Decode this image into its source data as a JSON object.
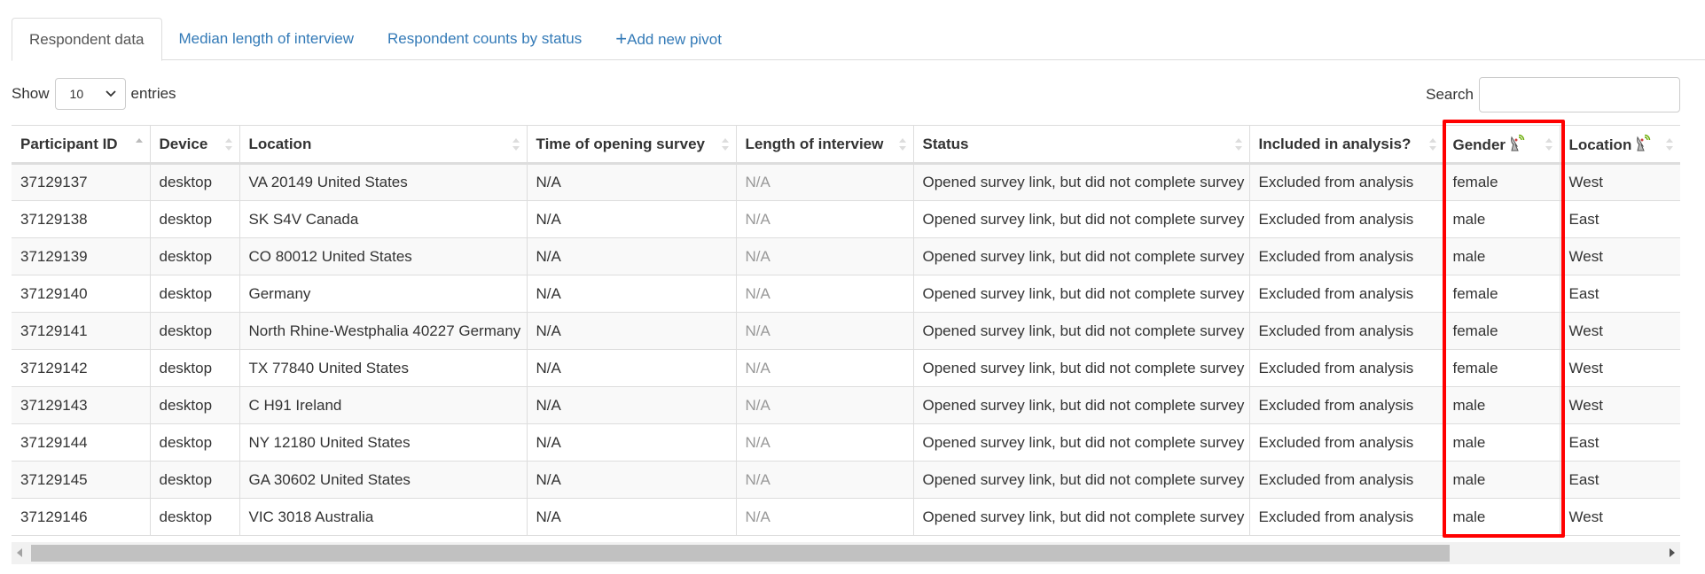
{
  "tabs": [
    {
      "label": "Respondent data",
      "active": true
    },
    {
      "label": "Median length of interview"
    },
    {
      "label": "Respondent counts by status"
    },
    {
      "label": "Add new pivot",
      "icon": "plus-icon"
    }
  ],
  "length": {
    "show": "Show",
    "value": "10",
    "entries": "entries"
  },
  "search": {
    "label": "Search",
    "value": ""
  },
  "columns": [
    "Participant ID",
    "Device",
    "Location",
    "Time of opening survey",
    "Length of interview",
    "Status",
    "Included in analysis?",
    "Gender",
    "Location"
  ],
  "rows": [
    [
      "37129137",
      "desktop",
      "VA 20149 United States",
      "N/A",
      "N/A",
      "Opened survey link, but did not complete survey",
      "Excluded from analysis",
      "female",
      "West"
    ],
    [
      "37129138",
      "desktop",
      "SK S4V Canada",
      "N/A",
      "N/A",
      "Opened survey link, but did not complete survey",
      "Excluded from analysis",
      "male",
      "East"
    ],
    [
      "37129139",
      "desktop",
      "CO 80012 United States",
      "N/A",
      "N/A",
      "Opened survey link, but did not complete survey",
      "Excluded from analysis",
      "male",
      "West"
    ],
    [
      "37129140",
      "desktop",
      "Germany",
      "N/A",
      "N/A",
      "Opened survey link, but did not complete survey",
      "Excluded from analysis",
      "female",
      "East"
    ],
    [
      "37129141",
      "desktop",
      "North Rhine-Westphalia 40227 Germany",
      "N/A",
      "N/A",
      "Opened survey link, but did not complete survey",
      "Excluded from analysis",
      "female",
      "West"
    ],
    [
      "37129142",
      "desktop",
      "TX 77840 United States",
      "N/A",
      "N/A",
      "Opened survey link, but did not complete survey",
      "Excluded from analysis",
      "female",
      "West"
    ],
    [
      "37129143",
      "desktop",
      "C H91 Ireland",
      "N/A",
      "N/A",
      "Opened survey link, but did not complete survey",
      "Excluded from analysis",
      "male",
      "West"
    ],
    [
      "37129144",
      "desktop",
      "NY 12180 United States",
      "N/A",
      "N/A",
      "Opened survey link, but did not complete survey",
      "Excluded from analysis",
      "male",
      "East"
    ],
    [
      "37129145",
      "desktop",
      "GA 30602 United States",
      "N/A",
      "N/A",
      "Opened survey link, but did not complete survey",
      "Excluded from analysis",
      "male",
      "East"
    ],
    [
      "37129146",
      "desktop",
      "VIC 3018 Australia",
      "N/A",
      "N/A",
      "Opened survey link, but did not complete survey",
      "Excluded from analysis",
      "male",
      "West"
    ]
  ],
  "highlight_color": "#ff0000",
  "link_color": "#337ab7"
}
